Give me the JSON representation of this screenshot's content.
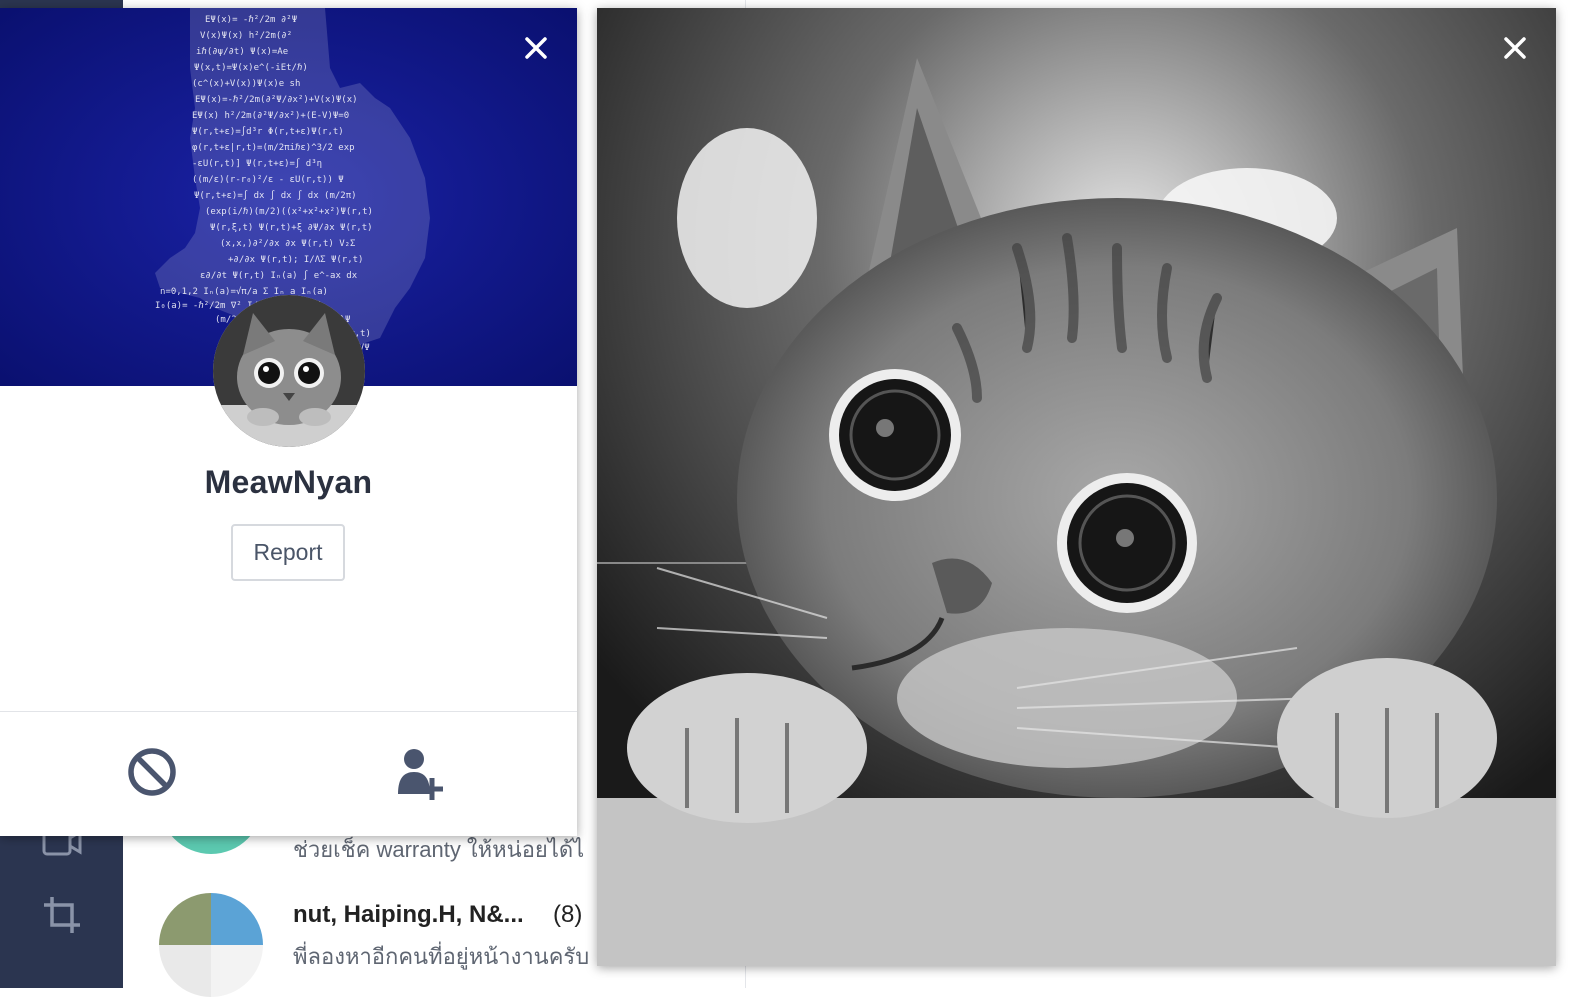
{
  "profile": {
    "name": "MeawNyan",
    "report_label": "Report"
  },
  "chat_list": {
    "items": [
      {
        "preview": "ช่วยเช็ค warranty ให้หน่อยได้ไ"
      },
      {
        "name": "nut, Haiping.H, N&...",
        "count": "(8)",
        "preview": "พี่ลองหาอีกคนที่อยู่หน้างานครับ"
      }
    ]
  },
  "colors": {
    "rail": "#2b3550",
    "cover": "#10178d",
    "icon": "#4a556e"
  },
  "icons": {
    "close": "close-icon",
    "block": "block-icon",
    "add_friend": "add-friend-icon",
    "crop": "crop-icon",
    "video": "video-icon"
  }
}
